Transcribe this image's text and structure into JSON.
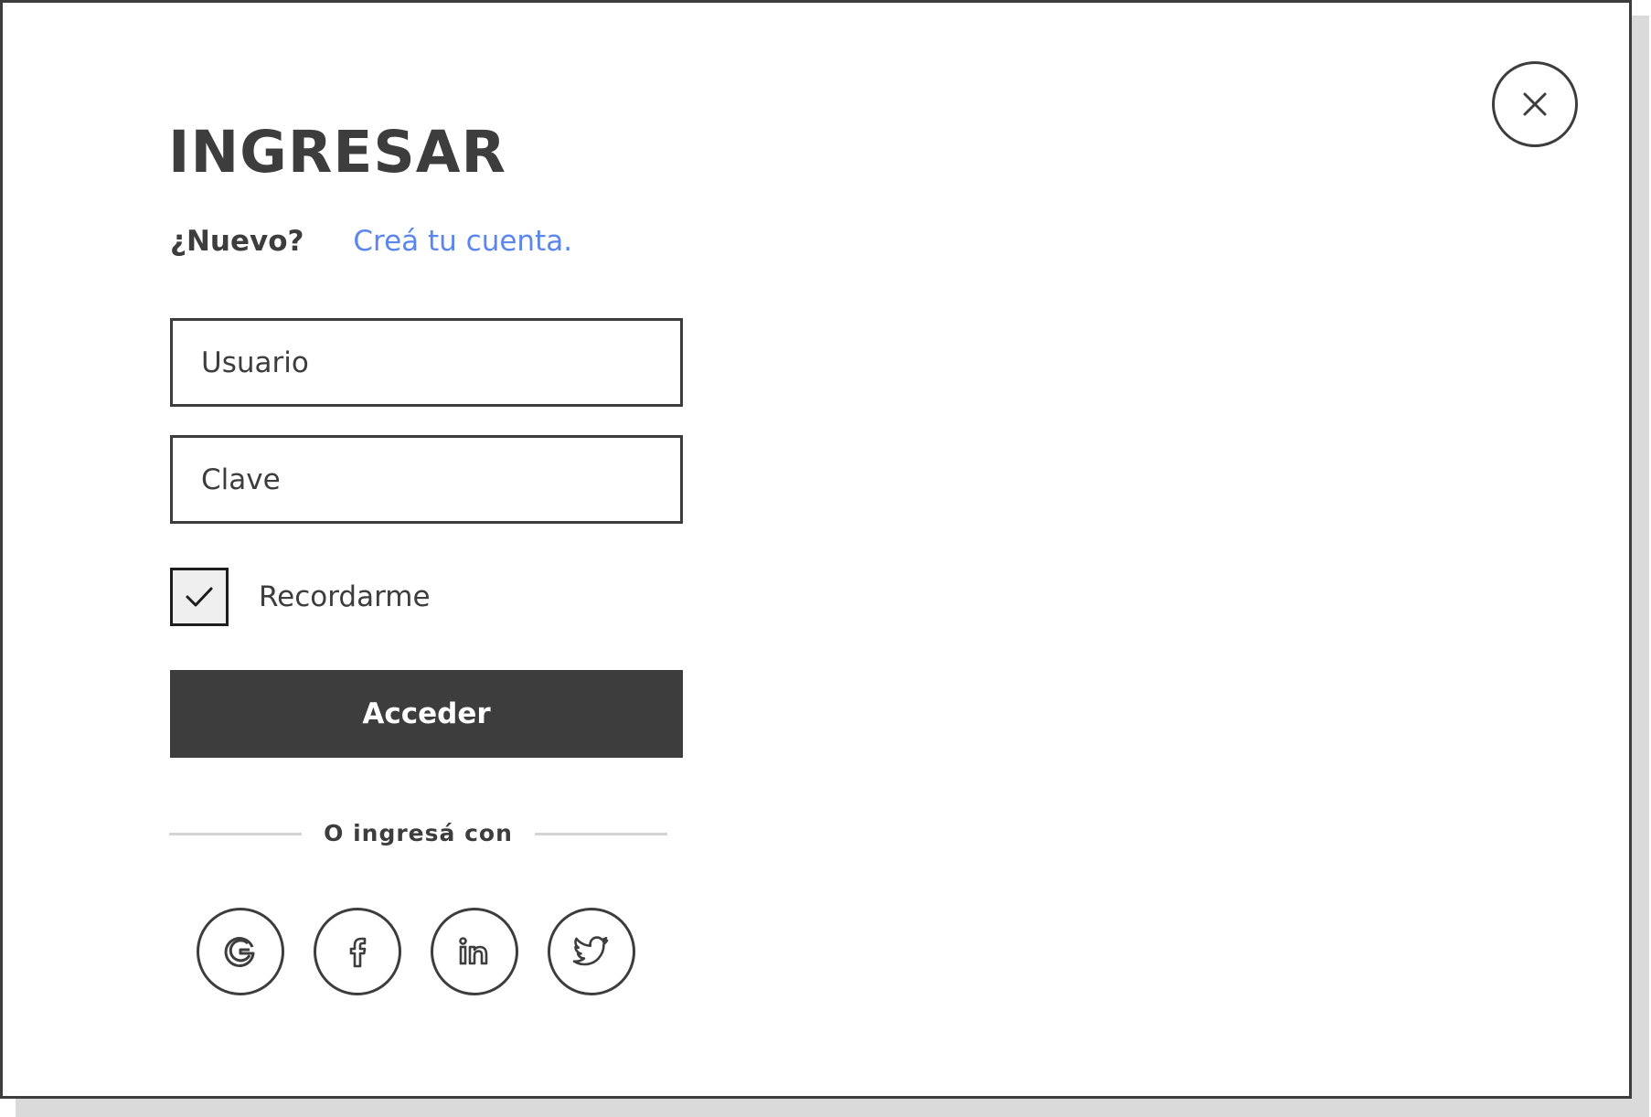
{
  "dialog": {
    "title": "INGRESAR",
    "new_prompt": "¿Nuevo?",
    "create_account_link": "Creá tu cuenta.",
    "close_icon": "close-icon"
  },
  "form": {
    "username_placeholder": "Usuario",
    "username_value": "",
    "password_placeholder": "Clave",
    "password_value": "",
    "remember_label": "Recordarme",
    "remember_checked": true,
    "submit_label": "Acceder"
  },
  "social": {
    "divider_label": "O ingresá con",
    "providers": [
      {
        "name": "Google",
        "icon": "google-icon"
      },
      {
        "name": "Facebook",
        "icon": "facebook-icon"
      },
      {
        "name": "LinkedIn",
        "icon": "linkedin-icon"
      },
      {
        "name": "Twitter",
        "icon": "twitter-icon"
      }
    ]
  },
  "colors": {
    "text": "#3d3d3d",
    "link": "#5b86f0",
    "button_bg": "#3d3d3d",
    "button_text": "#ffffff",
    "divider": "#d4d4d4"
  }
}
